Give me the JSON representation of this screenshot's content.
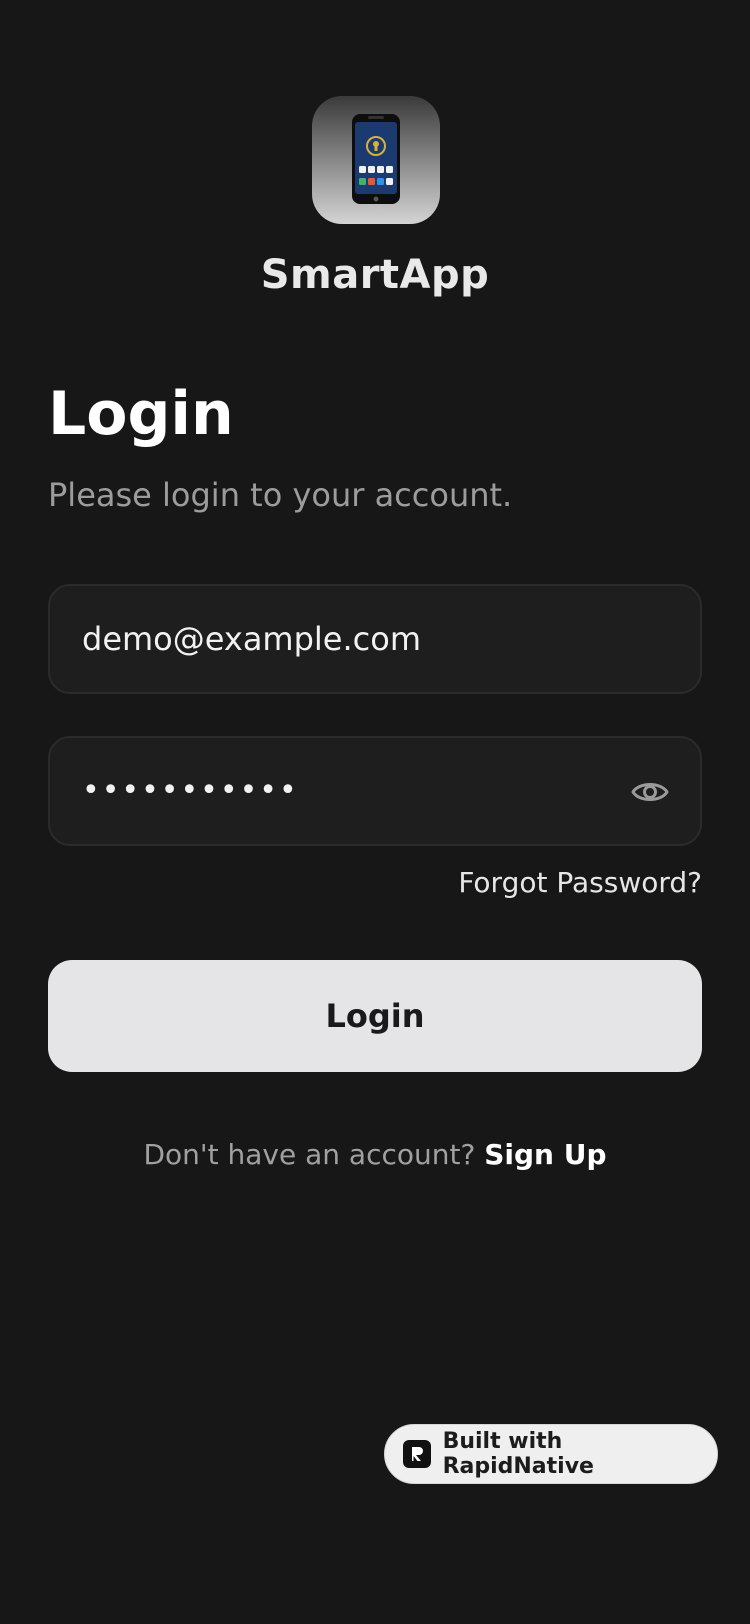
{
  "app": {
    "name": "SmartApp",
    "icon": "phone-app-icon"
  },
  "header": {
    "title": "Login",
    "subtitle": "Please login to your account."
  },
  "form": {
    "email_value": "demo@example.com",
    "password_masked": "•••••••••••",
    "password_toggle_icon": "eye-icon",
    "forgot_label": "Forgot Password?",
    "login_label": "Login"
  },
  "signup": {
    "prompt": "Don't have an account?",
    "link_label": "Sign Up"
  },
  "badge": {
    "label": "Built with RapidNative",
    "icon": "rapidnative-logo-icon"
  },
  "colors": {
    "background": "#171717",
    "field_background": "#1e1e1e",
    "button_background": "#e5e5e7",
    "muted_text": "#9c9c9c"
  }
}
